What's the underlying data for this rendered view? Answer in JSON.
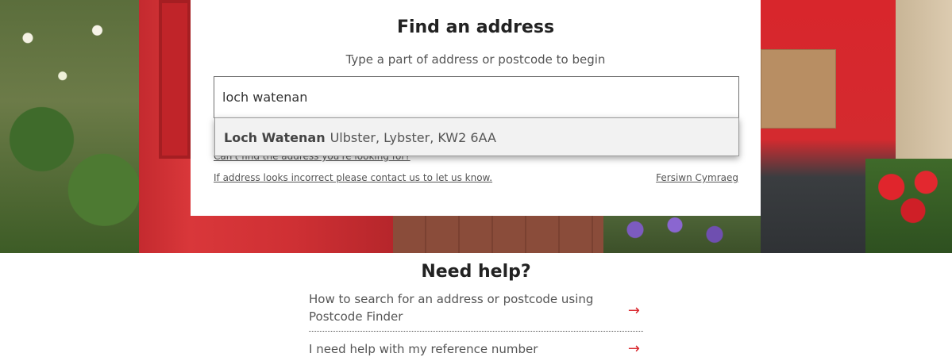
{
  "card": {
    "title": "Find an address",
    "subtitle": "Type a part of address or postcode to begin",
    "search_value": "loch watenan",
    "cant_find_link": "Can't find the address you're looking for?",
    "contact_link": "If address looks incorrect please contact us to let us know.",
    "welsh_link": "Fersiwn Cymraeg"
  },
  "autocomplete": {
    "items": [
      {
        "main": "Loch Watenan",
        "rest": "Ulbster, Lybster, KW2 6AA"
      }
    ]
  },
  "help": {
    "title": "Need help?",
    "items": [
      {
        "label": "How to search for an address or postcode using Postcode Finder",
        "icon": "arrow-right-icon"
      },
      {
        "label": "I need help with my reference number",
        "icon": "arrow-right-icon"
      }
    ]
  },
  "colors": {
    "accent": "#d9262c",
    "text": "#555555",
    "heading": "#222222"
  }
}
